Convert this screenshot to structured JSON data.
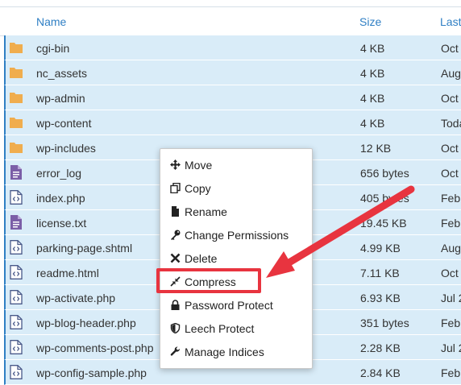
{
  "header": {
    "name": "Name",
    "size": "Size",
    "last": "Last"
  },
  "rows": [
    {
      "name": "cgi-bin",
      "size": "4 KB",
      "date": "Oct",
      "icon": "folder-icon"
    },
    {
      "name": "nc_assets",
      "size": "4 KB",
      "date": "Aug",
      "icon": "folder-icon"
    },
    {
      "name": "wp-admin",
      "size": "4 KB",
      "date": "Oct",
      "icon": "folder-icon"
    },
    {
      "name": "wp-content",
      "size": "4 KB",
      "date": "Toda",
      "icon": "folder-icon"
    },
    {
      "name": "wp-includes",
      "size": "12 KB",
      "date": "Oct",
      "icon": "folder-icon"
    },
    {
      "name": "error_log",
      "size": "656 bytes",
      "date": "Oct",
      "icon": "text-file-icon"
    },
    {
      "name": "index.php",
      "size": "405 bytes",
      "date": "Feb",
      "icon": "code-file-icon"
    },
    {
      "name": "license.txt",
      "size": "19.45 KB",
      "date": "Feb",
      "icon": "text-file-icon"
    },
    {
      "name": "parking-page.shtml",
      "size": "4.99 KB",
      "date": "Aug",
      "icon": "code-file-icon"
    },
    {
      "name": "readme.html",
      "size": "7.11 KB",
      "date": "Oct",
      "icon": "code-file-icon"
    },
    {
      "name": "wp-activate.php",
      "size": "6.93 KB",
      "date": "Jul 2",
      "icon": "code-file-icon"
    },
    {
      "name": "wp-blog-header.php",
      "size": "351 bytes",
      "date": "Feb",
      "icon": "code-file-icon"
    },
    {
      "name": "wp-comments-post.php",
      "size": "2.28 KB",
      "date": "Jul 2",
      "icon": "code-file-icon"
    },
    {
      "name": "wp-config-sample.php",
      "size": "2.84 KB",
      "date": "Feb",
      "icon": "code-file-icon"
    }
  ],
  "context_menu": [
    {
      "label": "Move",
      "icon": "move-icon"
    },
    {
      "label": "Copy",
      "icon": "copy-icon"
    },
    {
      "label": "Rename",
      "icon": "rename-icon"
    },
    {
      "label": "Change Permissions",
      "icon": "key-icon"
    },
    {
      "label": "Delete",
      "icon": "delete-icon"
    },
    {
      "label": "Compress",
      "icon": "compress-icon"
    },
    {
      "label": "Password Protect",
      "icon": "lock-icon"
    },
    {
      "label": "Leech Protect",
      "icon": "shield-icon"
    },
    {
      "label": "Manage Indices",
      "icon": "wrench-icon"
    }
  ],
  "colors": {
    "row_bg": "#d9ecf8",
    "accent": "#2f7fc4",
    "folder": "#f0ad4e",
    "text_file": "#7b5ea7",
    "annotation": "#e8343f"
  }
}
